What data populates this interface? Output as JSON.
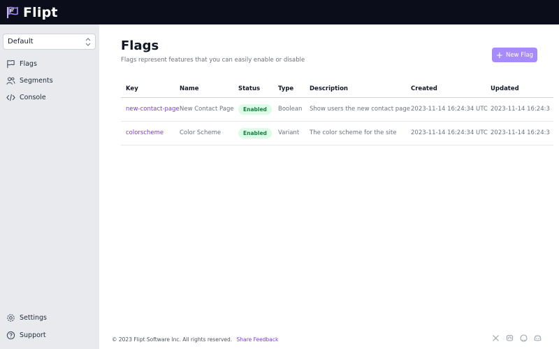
{
  "app": {
    "name": "Flipt"
  },
  "sidebar": {
    "namespace": "Default",
    "items": [
      {
        "label": "Flags"
      },
      {
        "label": "Segments"
      },
      {
        "label": "Console"
      }
    ],
    "bottom_items": [
      {
        "label": "Settings"
      },
      {
        "label": "Support"
      }
    ]
  },
  "main": {
    "title": "Flags",
    "subtitle": "Flags represent features that you can easily enable or disable",
    "new_flag_label": "New Flag",
    "table": {
      "headers": [
        "Key",
        "Name",
        "Status",
        "Type",
        "Description",
        "Created",
        "Updated"
      ],
      "rows": [
        {
          "key": "new-contact-page",
          "name": "New Contact Page",
          "status": "Enabled",
          "type": "Boolean",
          "description": "Show users the new contact page",
          "created": "2023-11-14 16:24:34 UTC",
          "updated": "2023-11-14 16:24:3"
        },
        {
          "key": "colorscheme",
          "name": "Color Scheme",
          "status": "Enabled",
          "type": "Variant",
          "description": "The color scheme for the site",
          "created": "2023-11-14 16:24:34 UTC",
          "updated": "2023-11-14 16:24:3"
        }
      ]
    }
  },
  "footer": {
    "copyright": "© 2023 Flipt Software Inc. All rights reserved.",
    "feedback_label": "Share Feedback",
    "icons": [
      "x-icon",
      "mastodon-icon",
      "github-icon",
      "discord-icon"
    ]
  },
  "colors": {
    "topbar": "#0b0d1a",
    "accent": "#a78bfa",
    "link": "#7c3aed",
    "badge_bg": "#dcfce7",
    "badge_text": "#15803d"
  }
}
